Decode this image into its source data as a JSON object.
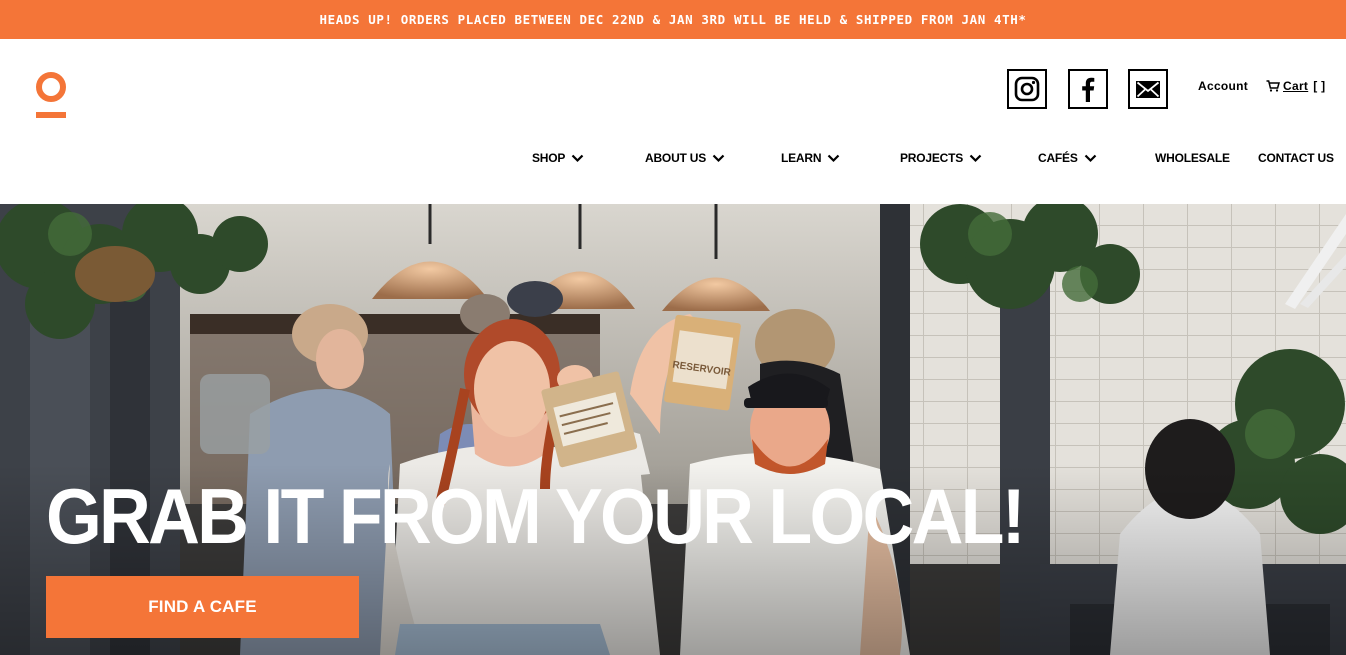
{
  "banner": {
    "text": "HEADS UP! ORDERS PLACED BETWEEN DEC 22ND & JAN 3RD WILL BE HELD & SHIPPED FROM JAN 4TH*"
  },
  "brand": {
    "logo_icon": "reservoir-o-logo",
    "accent": "#f47538"
  },
  "social": [
    {
      "icon": "instagram-icon"
    },
    {
      "icon": "facebook-icon"
    },
    {
      "icon": "mail-icon"
    }
  ],
  "utility": {
    "account_label": "Account",
    "cart_label": "Cart",
    "cart_count": "[ ]"
  },
  "nav": [
    {
      "label": "SHOP",
      "has_dropdown": true
    },
    {
      "label": "ABOUT US",
      "has_dropdown": true
    },
    {
      "label": "LEARN",
      "has_dropdown": true
    },
    {
      "label": "PROJECTS",
      "has_dropdown": true
    },
    {
      "label": "CAFÉS",
      "has_dropdown": true
    },
    {
      "label": "WHOLESALE",
      "has_dropdown": false
    },
    {
      "label": "CONTACT US",
      "has_dropdown": false
    }
  ],
  "hero": {
    "title": "GRAB IT FROM YOUR LOCAL!",
    "cta_label": "FIND A CAFE",
    "bag_label": "RESERVOIR"
  }
}
